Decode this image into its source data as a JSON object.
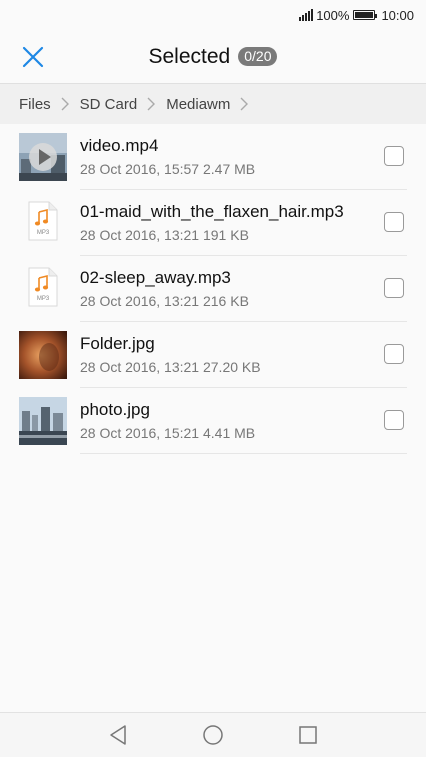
{
  "status": {
    "battery": "100%",
    "time": "10:00"
  },
  "header": {
    "title": "Selected",
    "count": "0/20"
  },
  "breadcrumb": [
    "Files",
    "SD Card",
    "Mediawm"
  ],
  "files": [
    {
      "name": "video.mp4",
      "date": "28 Oct 2016, 15:57",
      "size": "2.47 MB",
      "type": "video",
      "icon": "video-thumbnail"
    },
    {
      "name": "01-maid_with_the_flaxen_hair.mp3",
      "date": "28 Oct 2016, 13:21",
      "size": "191 KB",
      "type": "audio",
      "icon": "mp3-file-icon",
      "icon_label": "MP3"
    },
    {
      "name": "02-sleep_away.mp3",
      "date": "28 Oct 2016, 13:21",
      "size": "216 KB",
      "type": "audio",
      "icon": "mp3-file-icon",
      "icon_label": "MP3"
    },
    {
      "name": "Folder.jpg",
      "date": "28 Oct 2016, 13:21",
      "size": "27.20 KB",
      "type": "image",
      "icon": "image-thumbnail"
    },
    {
      "name": "photo.jpg",
      "date": "28 Oct 2016, 15:21",
      "size": "4.41 MB",
      "type": "image",
      "icon": "image-thumbnail"
    }
  ],
  "nav": {
    "back": "back-icon",
    "home": "home-icon",
    "recents": "recents-icon"
  },
  "colors": {
    "accent": "#1e88e5",
    "mp3": "#f08a24",
    "badge": "#7a7a7a"
  }
}
